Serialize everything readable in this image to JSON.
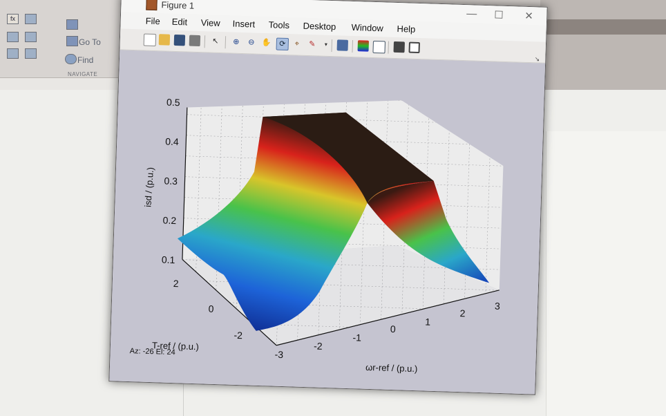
{
  "figure": {
    "title": "Figure 1",
    "menus": [
      "File",
      "Edit",
      "View",
      "Insert",
      "Tools",
      "Desktop",
      "Window",
      "Help"
    ]
  },
  "desktop": {
    "goto_label": "Go To",
    "find_label": "Find",
    "navigate_label": "NAVIGATE"
  },
  "toolbar_icons": [
    "new-figure-icon",
    "open-file-icon",
    "save-icon",
    "print-icon",
    "select-arrow-icon",
    "zoom-in-icon",
    "zoom-out-icon",
    "pan-hand-icon",
    "rotate-3d-icon",
    "data-cursor-icon",
    "brush-icon",
    "link-plot-icon",
    "colorbar-icon",
    "legend-icon",
    "hide-plot-tools-icon",
    "show-plot-tools-icon"
  ],
  "plot": {
    "view_readout": "Az: -26 El: 24",
    "colors": {
      "high": "#2a1a10",
      "mid_red": "#d8221b",
      "mid_green": "#3fb94b",
      "low_blue": "#0a1a7a",
      "background": "#c5c4d0"
    }
  },
  "chart_data": {
    "type": "surface",
    "title": "",
    "xlabel": "ωr-ref / (p.u.)",
    "ylabel": "T-ref / (p.u.)",
    "zlabel": "isd / (p.u.)",
    "xlim": [
      -3,
      3
    ],
    "ylim": [
      -3,
      3
    ],
    "zlim": [
      0.1,
      0.5
    ],
    "x_ticks": [
      "-3",
      "-2",
      "-1",
      "0",
      "1",
      "2",
      "3"
    ],
    "y_ticks": [
      "-2",
      "0",
      "2"
    ],
    "z_ticks": [
      "0.1",
      "0.2",
      "0.3",
      "0.4",
      "0.5"
    ],
    "grid": true,
    "colormap": "jet",
    "view": {
      "azimuth": -26,
      "elevation": 24
    },
    "surface_description_values": {
      "plateau_isd": 0.5,
      "plateau_omega_range": [
        -1.5,
        1.5
      ],
      "edge_isd_low": 0.12,
      "edge_isd_at_omega_minus3": 0.2,
      "edge_isd_at_omega_plus3": 0.12
    }
  }
}
